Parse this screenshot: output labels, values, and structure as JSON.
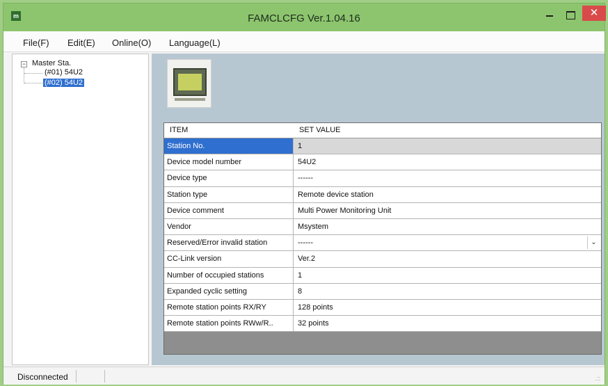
{
  "window": {
    "title": "FAMCLCFG Ver.1.04.16",
    "app_icon_text": "m",
    "close_glyph": "✕"
  },
  "menu": {
    "file": "File(F)",
    "edit": "Edit(E)",
    "online": "Online(O)",
    "language": "Language(L)"
  },
  "tree": {
    "root": "Master Sta.",
    "collapse_glyph": "−",
    "children": [
      {
        "label": "(#01) 54U2",
        "selected": false
      },
      {
        "label": "(#02) 54U2",
        "selected": true
      }
    ]
  },
  "grid": {
    "headers": {
      "item": "ITEM",
      "value": "SET VALUE"
    },
    "rows": [
      {
        "item": "Station No.",
        "value": "1"
      },
      {
        "item": "Device model number",
        "value": "54U2"
      },
      {
        "item": "Device type",
        "value": "------"
      },
      {
        "item": "Station type",
        "value": "Remote device station"
      },
      {
        "item": "Device comment",
        "value": "Multi Power Monitoring Unit"
      },
      {
        "item": "Vendor",
        "value": "Msystem"
      },
      {
        "item": "Reserved/Error invalid station",
        "value": "------"
      },
      {
        "item": "CC-Link version",
        "value": "Ver.2"
      },
      {
        "item": "Number of occupied stations",
        "value": "1"
      },
      {
        "item": "Expanded cyclic setting",
        "value": "8"
      },
      {
        "item": "Remote station points RX/RY",
        "value": "128 points"
      },
      {
        "item": "Remote station points RWw/R..",
        "value": "32 points"
      }
    ],
    "dropdown_glyph": "⌄"
  },
  "status": {
    "connection": "Disconnected",
    "grip": ".::"
  }
}
